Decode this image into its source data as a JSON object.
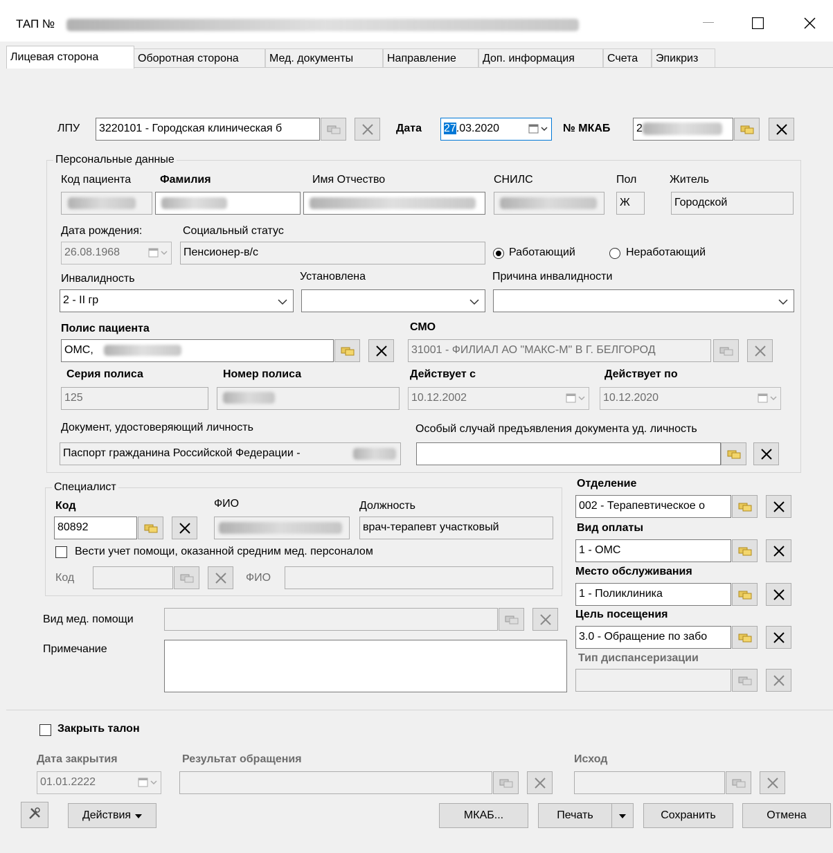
{
  "window": {
    "title": "ТАП №"
  },
  "tabs": [
    "Лицевая сторона",
    "Оборотная сторона",
    "Мед. документы",
    "Направление",
    "Доп. информация",
    "Счета",
    "Эпикриз"
  ],
  "header": {
    "lpu_label": "ЛПУ",
    "lpu_value": "3220101 - Городская клиническая б",
    "date_label": "Дата",
    "date_value_sel": "27",
    "date_value_rest": ".03.2020",
    "mkab_label": "№ МКАБ",
    "mkab_value": "2"
  },
  "personal": {
    "group_title": "Персональные данные",
    "code_label": "Код пациента",
    "surname_label": "Фамилия",
    "name_label": "Имя Отчество",
    "snils_label": "СНИЛС",
    "sex_label": "Пол",
    "sex_value": "Ж",
    "resident_label": "Житель",
    "resident_value": "Городской",
    "dob_label": "Дата рождения:",
    "dob_value": "26.08.1968",
    "social_label": "Социальный статус",
    "social_value": "Пенсионер-в/с",
    "working_label": "Работающий",
    "nonworking_label": "Неработающий",
    "disability_label": "Инвалидность",
    "disability_value": "2 - II гр",
    "established_label": "Установлена",
    "established_value": "",
    "reason_label": "Причина инвалидности",
    "reason_value": "",
    "policy_label": "Полис пациента",
    "policy_value": "ОМС,",
    "smo_label": "СМО",
    "smo_value": "31001 - ФИЛИАЛ АО \"МАКС-М\" В Г. БЕЛГОРОД",
    "series_label": "Серия полиса",
    "series_value": "125",
    "number_label": "Номер полиса",
    "valid_from_label": "Действует с",
    "valid_from_value": "10.12.2002",
    "valid_to_label": "Действует по",
    "valid_to_value": "10.12.2020",
    "doc_label": "Документ, удостоверяющий личность",
    "doc_value": "Паспорт гражданина Российской Федерации -",
    "special_label": "Особый случай предъявления документа уд. личность",
    "special_value": ""
  },
  "specialist": {
    "group_title": "Специалист",
    "code_label": "Код",
    "code_value": "80892",
    "fio_label": "ФИО",
    "position_label": "Должность",
    "position_value": "врач-терапевт участковый",
    "nurse_checkbox_label": "Вести учет помощи, оказанной средним мед. персоналом",
    "nurse_code_label": "Код",
    "nurse_fio_label": "ФИО"
  },
  "right": {
    "department_label": "Отделение",
    "department_value": "002 - Терапевтическое о",
    "payment_label": "Вид оплаты",
    "payment_value": "1 - ОМС",
    "place_label": "Место обслуживания",
    "place_value": "1 - Поликлиника",
    "purpose_label": "Цель посещения",
    "purpose_value": "3.0 - Обращение по забо",
    "dispensary_label": "Тип диспансеризации",
    "dispensary_value": ""
  },
  "misc": {
    "care_type_label": "Вид мед. помощи",
    "note_label": "Примечание"
  },
  "closing": {
    "close_label": "Закрыть талон",
    "close_date_label": "Дата закрытия",
    "close_date_value": "01.01.2222",
    "result_label": "Результат обращения",
    "outcome_label": "Исход"
  },
  "footer": {
    "actions": "Действия",
    "mkab": "МКАБ...",
    "print": "Печать",
    "save": "Сохранить",
    "cancel": "Отмена"
  }
}
